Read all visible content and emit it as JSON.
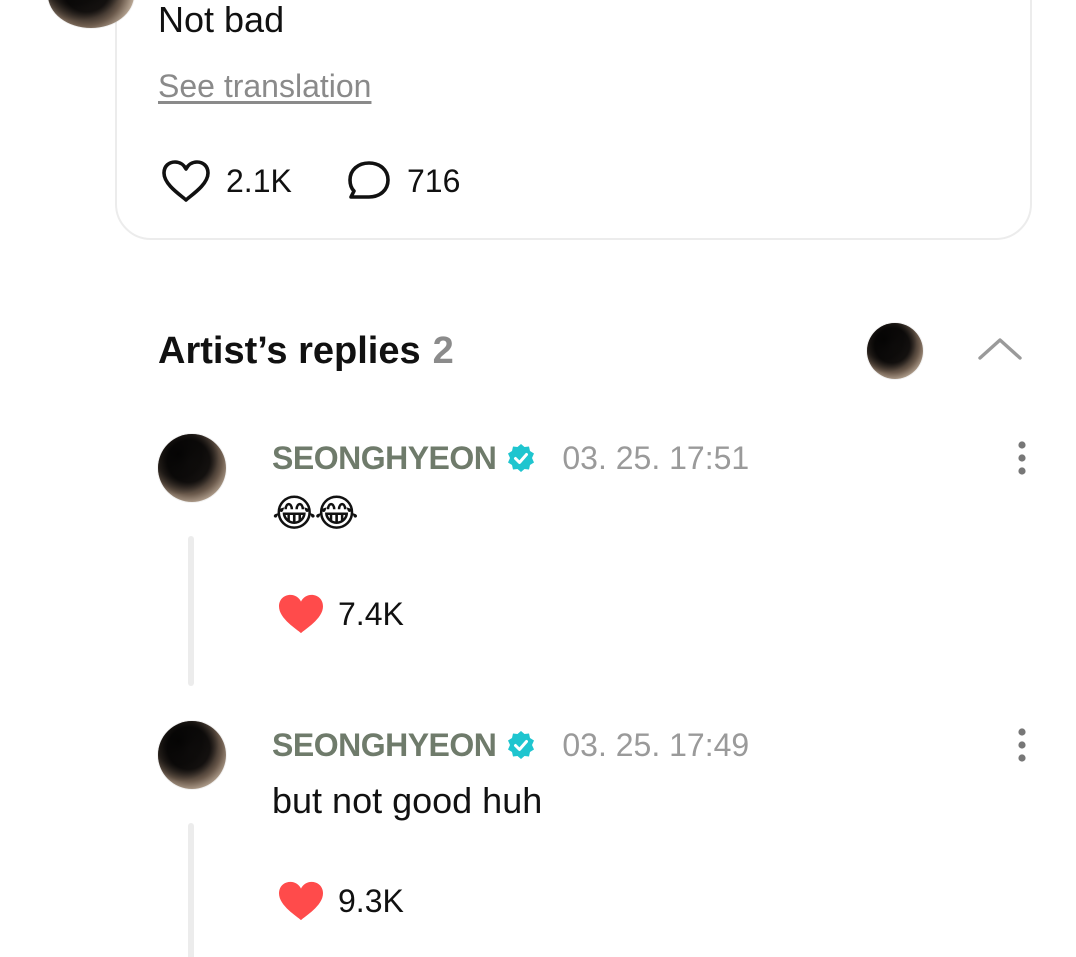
{
  "post": {
    "text": "Not bad",
    "see_translation": "See translation",
    "likes": "2.1K",
    "comments": "716"
  },
  "artist_replies": {
    "title": "Artist’s replies",
    "count": "2"
  },
  "replies": [
    {
      "name": "SEONGHYEON",
      "timestamp": "03. 25. 17:51",
      "body": "😂😂",
      "likes": "7.4K"
    },
    {
      "name": "SEONGHYEON",
      "timestamp": "03. 25. 17:49",
      "body": "but not good huh",
      "likes": "9.3K"
    }
  ],
  "colors": {
    "verified_badge": "#1fc5cf",
    "liked_heart": "#ff4b4b",
    "artist_name": "#6f7b6b",
    "muted_text": "#9a9a9a"
  },
  "icons": {
    "like": "heart-outline-icon",
    "comment": "speech-bubble-icon",
    "liked": "heart-filled-icon",
    "verified": "verified-badge-icon",
    "more": "more-vertical-icon",
    "collapse": "chevron-up-icon"
  }
}
